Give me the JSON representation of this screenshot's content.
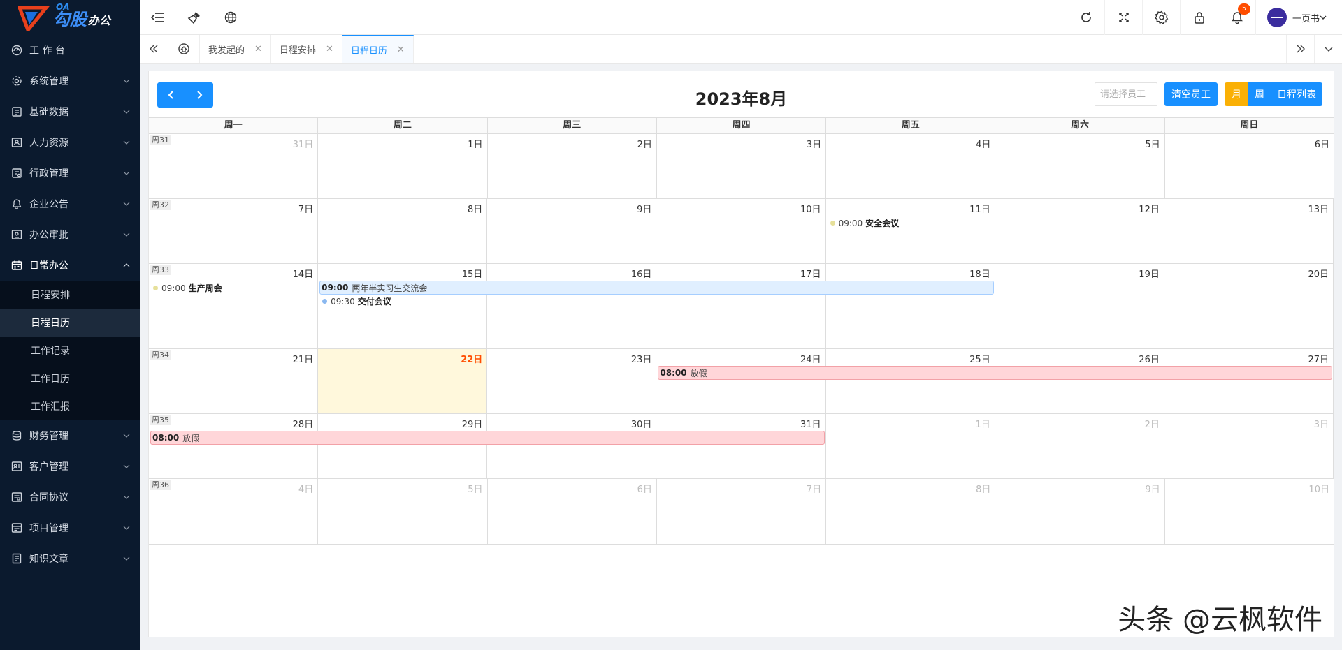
{
  "app": {
    "logo_oa": "OA",
    "logo_text": "勾股",
    "logo_sub": "办公"
  },
  "sidebar": {
    "items": [
      {
        "label": "工 作 台",
        "icon": "dashboard-icon",
        "expandable": false
      },
      {
        "label": "系统管理",
        "icon": "settings-icon",
        "expandable": true
      },
      {
        "label": "基础数据",
        "icon": "database-icon",
        "expandable": true
      },
      {
        "label": "人力资源",
        "icon": "user-card-icon",
        "expandable": true
      },
      {
        "label": "行政管理",
        "icon": "admin-icon",
        "expandable": true
      },
      {
        "label": "企业公告",
        "icon": "bell-icon",
        "expandable": true
      },
      {
        "label": "办公审批",
        "icon": "approval-icon",
        "expandable": true
      },
      {
        "label": "日常办公",
        "icon": "calendar-icon",
        "expandable": true,
        "expanded": true
      },
      {
        "label": "财务管理",
        "icon": "finance-icon",
        "expandable": true
      },
      {
        "label": "客户管理",
        "icon": "customer-icon",
        "expandable": true
      },
      {
        "label": "合同协议",
        "icon": "contract-icon",
        "expandable": true
      },
      {
        "label": "项目管理",
        "icon": "project-icon",
        "expandable": true
      },
      {
        "label": "知识文章",
        "icon": "article-icon",
        "expandable": true
      }
    ],
    "submenu": [
      {
        "label": "日程安排",
        "active": false
      },
      {
        "label": "日程日历",
        "active": true
      },
      {
        "label": "工作记录",
        "active": false
      },
      {
        "label": "工作日历",
        "active": false
      },
      {
        "label": "工作汇报",
        "active": false
      }
    ]
  },
  "topbar": {
    "notifications": "5",
    "user_name": "一页书"
  },
  "tabs": [
    {
      "label": "我发起的",
      "active": false
    },
    {
      "label": "日程安排",
      "active": false
    },
    {
      "label": "日程日历",
      "active": true
    }
  ],
  "calendar": {
    "title": "2023年8月",
    "employee_placeholder": "请选择员工",
    "clear_label": "清空员工",
    "views": [
      "月",
      "周",
      "日程列表"
    ],
    "active_view": "月",
    "weekdays": [
      "周一",
      "周二",
      "周三",
      "周四",
      "周五",
      "周六",
      "周日"
    ],
    "weeks": [
      {
        "label": "周31",
        "days": [
          [
            "31日",
            true
          ],
          [
            "1日",
            false
          ],
          [
            "2日",
            false
          ],
          [
            "3日",
            false
          ],
          [
            "4日",
            false
          ],
          [
            "5日",
            false
          ],
          [
            "6日",
            false
          ]
        ]
      },
      {
        "label": "周32",
        "days": [
          [
            "7日",
            false
          ],
          [
            "8日",
            false
          ],
          [
            "9日",
            false
          ],
          [
            "10日",
            false
          ],
          [
            "11日",
            false
          ],
          [
            "12日",
            false
          ],
          [
            "13日",
            false
          ]
        ]
      },
      {
        "label": "周33",
        "days": [
          [
            "14日",
            false
          ],
          [
            "15日",
            false
          ],
          [
            "16日",
            false
          ],
          [
            "17日",
            false
          ],
          [
            "18日",
            false
          ],
          [
            "19日",
            false
          ],
          [
            "20日",
            false
          ]
        ]
      },
      {
        "label": "周34",
        "days": [
          [
            "21日",
            false
          ],
          [
            "22日",
            false
          ],
          [
            "23日",
            false
          ],
          [
            "24日",
            false
          ],
          [
            "25日",
            false
          ],
          [
            "26日",
            false
          ],
          [
            "27日",
            false
          ]
        ]
      },
      {
        "label": "周35",
        "days": [
          [
            "28日",
            false
          ],
          [
            "29日",
            false
          ],
          [
            "30日",
            false
          ],
          [
            "31日",
            false
          ],
          [
            "1日",
            true
          ],
          [
            "2日",
            true
          ],
          [
            "3日",
            true
          ]
        ]
      },
      {
        "label": "周36",
        "days": [
          [
            "4日",
            true
          ],
          [
            "5日",
            true
          ],
          [
            "6日",
            true
          ],
          [
            "7日",
            true
          ],
          [
            "8日",
            true
          ],
          [
            "9日",
            true
          ],
          [
            "10日",
            true
          ]
        ]
      }
    ],
    "today": "22日",
    "events": [
      {
        "type": "dot",
        "week": 1,
        "day": 4,
        "row": 0,
        "time": "09:00",
        "name": "安全会议",
        "color": "#e6e09a"
      },
      {
        "type": "dot",
        "week": 2,
        "day": 0,
        "row": 0,
        "time": "09:00",
        "name": "生产周会",
        "color": "#e6e09a"
      },
      {
        "type": "bar",
        "week": 2,
        "start": 1,
        "end": 4,
        "row": 0,
        "time": "09:00",
        "name": "两年半实习生交流会",
        "color": "blue"
      },
      {
        "type": "dot",
        "week": 2,
        "day": 1,
        "row": 1,
        "time": "09:30",
        "name": "交付会议",
        "color": "#8ab8f0"
      },
      {
        "type": "bar",
        "week": 3,
        "start": 3,
        "end": 6,
        "row": 0,
        "time": "08:00",
        "name": "放假",
        "color": "red"
      },
      {
        "type": "bar",
        "week": 4,
        "start": 0,
        "end": 3,
        "row": 0,
        "time": "08:00",
        "name": "放假",
        "color": "red"
      }
    ]
  },
  "watermark": "头条 @云枫软件"
}
